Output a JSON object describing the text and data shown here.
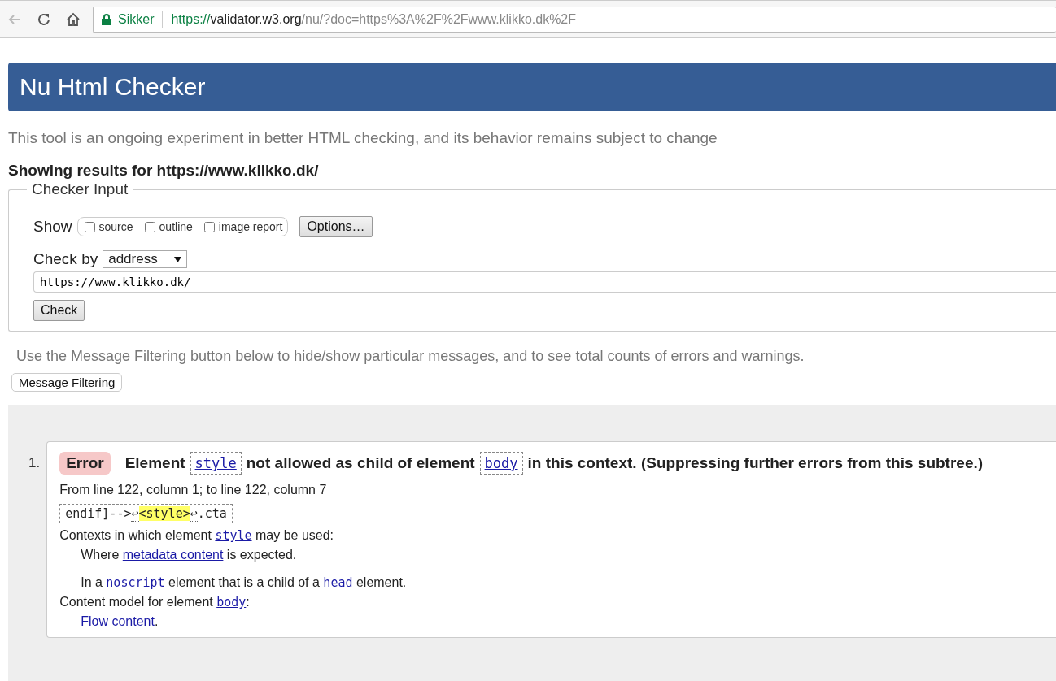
{
  "browser": {
    "security_label": "Sikker",
    "url_parts": [
      {
        "kind": "scheme",
        "text": "https://"
      },
      {
        "kind": "host",
        "text": "validator.w3.org"
      },
      {
        "kind": "path",
        "text": "/nu/?doc=https%3A%2F%2Fwww.klikko.dk%2F"
      }
    ]
  },
  "header": {
    "title": "Nu Html Checker"
  },
  "intro": "This tool is an ongoing experiment in better HTML checking, and its behavior remains subject to change",
  "results_heading": "Showing results for https://www.klikko.dk/",
  "checker_input": {
    "legend": "Checker Input",
    "show_label": "Show",
    "show_options": [
      {
        "label": "source",
        "checked": false
      },
      {
        "label": "outline",
        "checked": false
      },
      {
        "label": "image report",
        "checked": false
      }
    ],
    "options_button": "Options…",
    "check_by_label": "Check by",
    "check_by_value": "address",
    "address": "https://www.klikko.dk/",
    "check_button": "Check"
  },
  "filter_note": "Use the Message Filtering button below to hide/show particular messages, and to see total counts of errors and warnings.",
  "filter_button": "Message Filtering",
  "messages": [
    {
      "number": "1.",
      "kind": "error",
      "type_label": "Error",
      "title": [
        {
          "kind": "text",
          "text": "Element"
        },
        {
          "kind": "boxed_code",
          "text": "style"
        },
        {
          "kind": "text",
          "text": "not allowed as child of element"
        },
        {
          "kind": "boxed_code",
          "text": "body"
        },
        {
          "kind": "text",
          "text": "in this context. (Suppressing further errors from this subtree.)"
        }
      ],
      "location": "From line 122, column 1; to line 122, column 7",
      "extract": [
        {
          "kind": "plain",
          "text": "endif]-->"
        },
        {
          "kind": "linebreak",
          "text": "↩"
        },
        {
          "kind": "highlight",
          "text": "<style>"
        },
        {
          "kind": "linebreak",
          "text": "↩"
        },
        {
          "kind": "plain",
          "text": ".cta"
        }
      ],
      "details": [
        {
          "kind": "line",
          "parts": [
            {
              "kind": "text",
              "text": "Contexts in which element "
            },
            {
              "kind": "code",
              "text": "style"
            },
            {
              "kind": "text",
              "text": " may be used:"
            }
          ]
        },
        {
          "kind": "indented",
          "parts": [
            {
              "kind": "text",
              "text": "Where "
            },
            {
              "kind": "link",
              "text": "metadata content"
            },
            {
              "kind": "text",
              "text": " is expected."
            }
          ]
        },
        {
          "kind": "indented_spaced",
          "parts": [
            {
              "kind": "text",
              "text": "In a "
            },
            {
              "kind": "code",
              "text": "noscript"
            },
            {
              "kind": "text",
              "text": " element that is a child of a "
            },
            {
              "kind": "code",
              "text": "head"
            },
            {
              "kind": "text",
              "text": " element."
            }
          ]
        },
        {
          "kind": "line",
          "parts": [
            {
              "kind": "text",
              "text": "Content model for element "
            },
            {
              "kind": "code",
              "text": "body"
            },
            {
              "kind": "text",
              "text": ":"
            }
          ]
        },
        {
          "kind": "indented",
          "parts": [
            {
              "kind": "link",
              "text": "Flow content"
            },
            {
              "kind": "text",
              "text": "."
            }
          ]
        }
      ]
    }
  ]
}
